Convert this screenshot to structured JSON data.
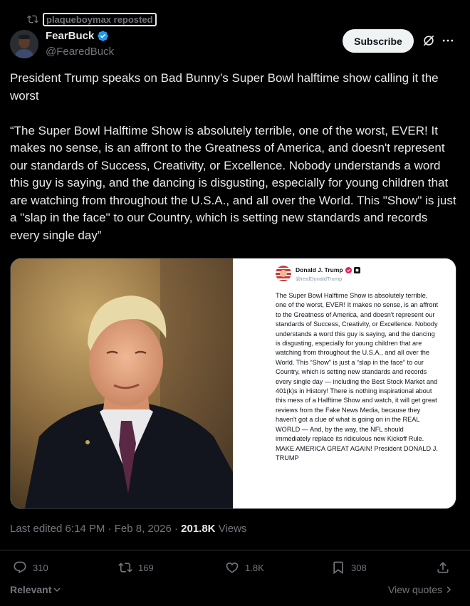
{
  "repost": {
    "label": "plaqueboymax reposted"
  },
  "author": {
    "display_name": "FearBuck",
    "handle": "@FearedBuck",
    "verified": true
  },
  "subscribe_label": "Subscribe",
  "tweet": {
    "text": "President Trump speaks on Bad Bunny’s Super Bowl halftime show calling it the worst\n\n“The Super Bowl Halftime Show is absolutely terrible, one of the worst, EVER! It makes no sense, is an affront to the Greatness of America, and doesn't represent our standards of Success, Creativity, or Excellence. Nobody understands a word this guy is saying, and the dancing is disgusting, especially for young children that are watching from throughout the U.S.A., and all over the World. This \"Show\" is just a \"slap in the face\" to our Country, which is setting new standards and records every single day”"
  },
  "media": {
    "card_name": "Donald J. Trump",
    "card_handle": "@realDonaldTrump",
    "card_text": "The Super Bowl Halftime Show is absolutely terrible, one of the worst, EVER! It makes no sense, is an affront to the Greatness of America, and doesn't represent our standards of Success, Creativity, or Excellence. Nobody understands a word this guy is saying, and the dancing is disgusting, especially for young children that are watching from throughout the U.S.A., and all over the World. This “Show” is just a “slap in the face” to our Country, which is setting new standards and records every single day — including the Best Stock Market and 401(k)s in History! There is nothing inspirational about this mess of a Halftime Show and watch, it will get great reviews from the Fake News Media, because they haven't got a clue of what is going on in the REAL WORLD — And, by the way, the NFL should immediately replace its ridiculous new Kickoff Rule. MAKE AMERICA GREAT AGAIN! President DONALD J. TRUMP"
  },
  "meta": {
    "edited": "Last edited 6:14 PM · Feb 8, 2026 · ",
    "views_count": "201.8K",
    "views_label": " Views"
  },
  "actions": {
    "replies": "310",
    "reposts": "169",
    "likes": "1.8K",
    "bookmarks": "308"
  },
  "footer": {
    "relevant": "Relevant",
    "view_quotes": "View quotes"
  },
  "colors": {
    "background": "#000000",
    "text": "#e7e9ea",
    "muted": "#71767b",
    "verified": "#1d9bf0",
    "divider": "#2f3336"
  },
  "icons": [
    "repost-icon",
    "verified-badge-icon",
    "grok-icon",
    "more-icon",
    "reply-icon",
    "like-icon",
    "bookmark-icon",
    "share-icon",
    "chevron-down-icon",
    "chevron-right-icon"
  ]
}
